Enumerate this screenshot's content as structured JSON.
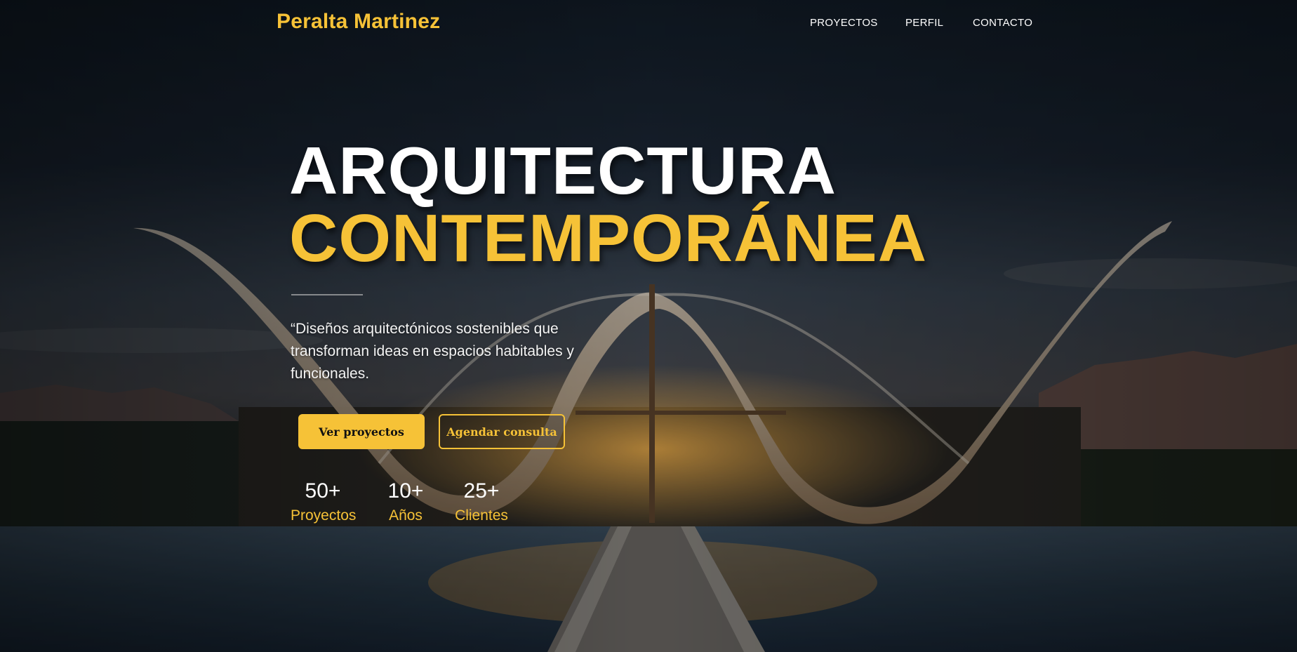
{
  "header": {
    "brand": "Peralta Martinez",
    "nav": [
      {
        "label": "PROYECTOS"
      },
      {
        "label": "PERFIL"
      },
      {
        "label": "CONTACTO"
      }
    ]
  },
  "hero": {
    "title_line1": "ARQUITECTURA",
    "title_line2": "CONTEMPORÁNEA",
    "quote": "“Diseños arquitectónicos sostenibles que transforman ideas en espacios habitables y funcionales.",
    "primary_button": "Ver proyectos",
    "secondary_button": "Agendar consulta",
    "stats": [
      {
        "value": "50+",
        "label": "Proyectos"
      },
      {
        "value": "10+",
        "label": "Años"
      },
      {
        "value": "25+",
        "label": "Clientes"
      }
    ]
  },
  "colors": {
    "accent": "#f6c237",
    "text_light": "#ffffff",
    "sky_dark": "#101a25"
  }
}
